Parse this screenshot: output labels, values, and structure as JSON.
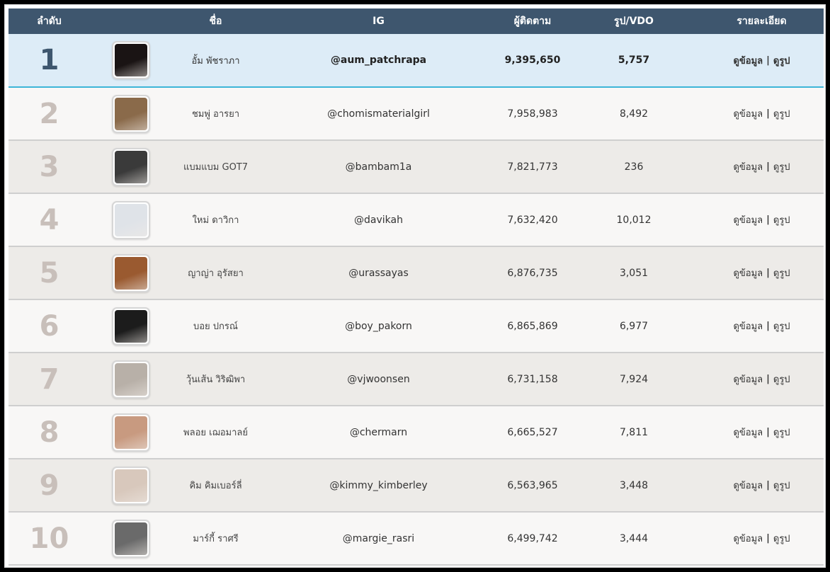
{
  "table": {
    "headers": {
      "rank": "ลำดับ",
      "name": "ชื่อ",
      "ig": "IG",
      "followers": "ผู้ติดตาม",
      "posts": "รูป/VDO",
      "details": "รายละเอียด"
    },
    "detail_link": "ดูข้อมูล",
    "photo_link": "ดูรูป",
    "separator": "|",
    "rows": [
      {
        "rank": "1",
        "name": "อั้ม พัชราภา",
        "ig": "@aum_patchrapa",
        "followers": "9,395,650",
        "posts": "5,757",
        "avatar_color": "#1a1414"
      },
      {
        "rank": "2",
        "name": "ชมพู่ อารยา",
        "ig": "@chomismaterialgirl",
        "followers": "7,958,983",
        "posts": "8,492",
        "avatar_color": "#8a6a4a"
      },
      {
        "rank": "3",
        "name": "แบมแบม GOT7",
        "ig": "@bambam1a",
        "followers": "7,821,773",
        "posts": "236",
        "avatar_color": "#3a3a3a"
      },
      {
        "rank": "4",
        "name": "ใหม่ ดาวิกา",
        "ig": "@davikah",
        "followers": "7,632,420",
        "posts": "10,012",
        "avatar_color": "#dfe3e8"
      },
      {
        "rank": "5",
        "name": "ญาญ่า อุรัสยา",
        "ig": "@urassayas",
        "followers": "6,876,735",
        "posts": "3,051",
        "avatar_color": "#9a5a30"
      },
      {
        "rank": "6",
        "name": "บอย ปกรณ์",
        "ig": "@boy_pakorn",
        "followers": "6,865,869",
        "posts": "6,977",
        "avatar_color": "#1c1c1c"
      },
      {
        "rank": "7",
        "name": "วุ้นเส้น วิริฒิพา",
        "ig": "@vjwoonsen",
        "followers": "6,731,158",
        "posts": "7,924",
        "avatar_color": "#b8b0a8"
      },
      {
        "rank": "8",
        "name": "พลอย เฌอมาลย์",
        "ig": "@chermarn",
        "followers": "6,665,527",
        "posts": "7,811",
        "avatar_color": "#c89a80"
      },
      {
        "rank": "9",
        "name": "คิม คิมเบอร์ลี่",
        "ig": "@kimmy_kimberley",
        "followers": "6,563,965",
        "posts": "3,448",
        "avatar_color": "#d8c8bc"
      },
      {
        "rank": "10",
        "name": "มาร์กี้ ราศรี",
        "ig": "@margie_rasri",
        "followers": "6,499,742",
        "posts": "3,444",
        "avatar_color": "#6a6a6a"
      }
    ]
  }
}
